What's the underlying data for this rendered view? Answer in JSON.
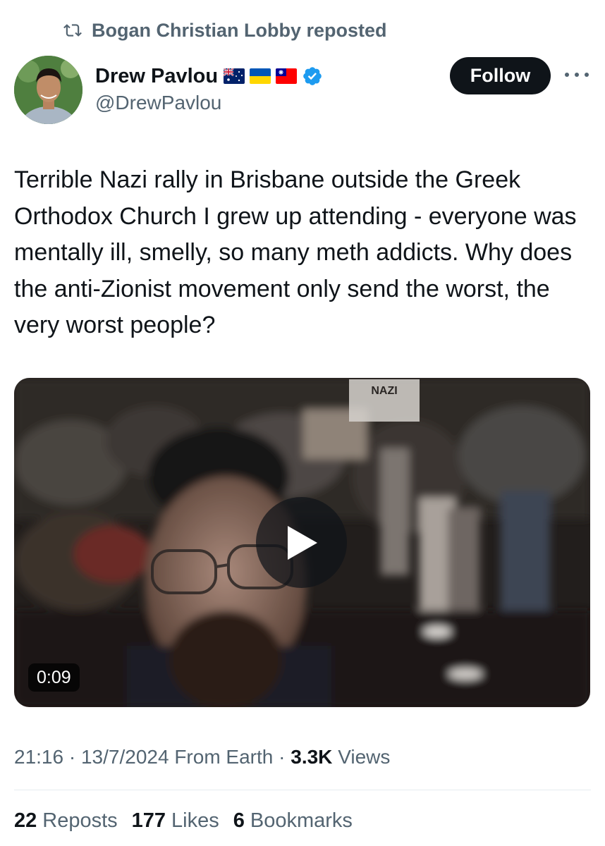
{
  "repost": {
    "icon": "repost-icon",
    "text": "Bogan Christian Lobby reposted"
  },
  "author": {
    "name": "Drew Pavlou",
    "handle": "@DrewPavlou",
    "flags": [
      "australia-flag-icon",
      "ukraine-flag-icon",
      "taiwan-flag-icon"
    ],
    "verified": true
  },
  "follow_label": "Follow",
  "tweet": {
    "text": "Terrible Nazi rally in Brisbane outside the Greek Orthodox Church I grew up attending - everyone was mentally ill, smelly, so many meth addicts. Why does the anti-Zionist movement only send the worst, the very worst people?"
  },
  "video": {
    "duration": "0:09",
    "sign_text": "NAZI"
  },
  "meta": {
    "time": "21:16",
    "date": "13/7/2024",
    "source": "From Earth",
    "views_count": "3.3K",
    "views_label": "Views"
  },
  "stats": {
    "reposts_count": "22",
    "reposts_label": "Reposts",
    "likes_count": "177",
    "likes_label": "Likes",
    "bookmarks_count": "6",
    "bookmarks_label": "Bookmarks"
  },
  "colors": {
    "text": "#0f1419",
    "secondary": "#536471",
    "verified": "#1d9bf0",
    "button": "#0f1419"
  }
}
